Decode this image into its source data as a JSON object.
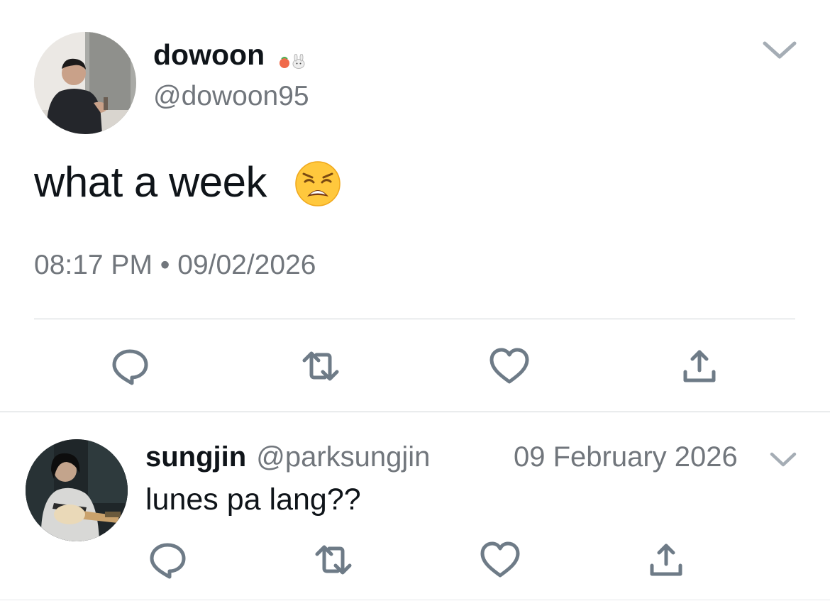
{
  "main_tweet": {
    "author": {
      "name": "dowoon",
      "name_emojis": [
        "peach-emoji",
        "rabbit-emoji"
      ],
      "handle": "@dowoon95",
      "avatar": "profile-photo"
    },
    "text": "what a week",
    "text_emoji": "weary-face-emoji",
    "timestamp": "08:17 PM • 09/02/2026",
    "actions": [
      "reply-icon",
      "retweet-icon",
      "like-icon",
      "share-icon"
    ],
    "menu_icon": "chevron-down-icon"
  },
  "reply_tweet": {
    "author": {
      "name": "sungjin",
      "handle": "@parksungjin",
      "avatar": "profile-photo"
    },
    "date": "09 February 2026",
    "text": "lunes pa lang??",
    "actions": [
      "reply-icon",
      "retweet-icon",
      "like-icon",
      "share-icon"
    ],
    "menu_icon": "chevron-down-icon"
  },
  "colors": {
    "text_primary": "#0f1419",
    "text_secondary": "#71767c",
    "icon": "#6e7b87",
    "divider": "#cfd3d6"
  }
}
